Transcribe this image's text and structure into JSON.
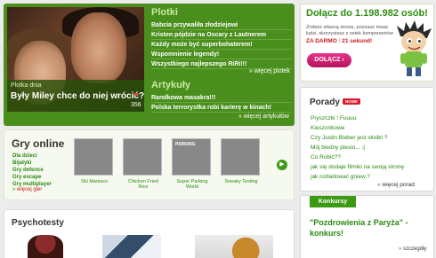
{
  "hero": {
    "tag": "Plotka dnia",
    "headline": "Były Miley chce do niej wrócić?",
    "count": "356"
  },
  "plotki": {
    "title": "Plotki",
    "items": [
      "Babcia przywaliła złodziejowi",
      "Kristen pójdzie na Oscary z Lautnerem",
      "Każdy może być superbohaterem!",
      "Wspomnienie legendy!",
      "Wszystkiego najlepszego RiRi!!!"
    ],
    "more": "więcej plotek"
  },
  "artykuly": {
    "title": "Artykuły",
    "items": [
      "Randkowa masakra!!!",
      "Polska terrorystka robi karierę w kinach!"
    ],
    "more": "więcej artykułów"
  },
  "join": {
    "title": "Dołącz do 1.198.982 osób!",
    "desc": "Zrobisz własną stronę, poznasz masę ludzi, skorzystasz z setek komponentów",
    "free": "ZA DARMO",
    "separator": "/",
    "seconds": "21 sekund!",
    "button": "DOŁĄCZ"
  },
  "porady": {
    "title": "Porady",
    "badge": "NOWE",
    "items": [
      "Pryszczki ! Fuuuu",
      "Kieszonkowe",
      "Czy Justin Bieber jest słodki ?",
      "Mój biedny piesio... :(",
      "Co Robić??",
      "jak się dodaje filmiki na swoją stronę",
      "jak rozładować gniew.?"
    ],
    "more": "więcej porad"
  },
  "gry": {
    "title": "Gry online",
    "categories": [
      "Dla dzieci",
      "Bijatyki",
      "Gry defence",
      "Gry escape",
      "Gry multiplayer"
    ],
    "more": "więcej gier",
    "games": [
      {
        "name": "Ski Maniacs"
      },
      {
        "name": "Chicken Fried Rice"
      },
      {
        "name": "Super Parking World"
      },
      {
        "name": "Sneaky Texting"
      }
    ],
    "parking_label": "PARKING"
  },
  "psychotesty": {
    "title": "Psychotesty"
  },
  "konkursy": {
    "tab": "Konkursy",
    "text": "\"Pozdrowienia z Paryża\" - konkurs!",
    "more": "szczegóły"
  },
  "colors": {
    "brand_green": "#4a8f1d",
    "link_green": "#2a8a12",
    "accent_red": "#c81a1a",
    "join_button": "#d4237a"
  }
}
